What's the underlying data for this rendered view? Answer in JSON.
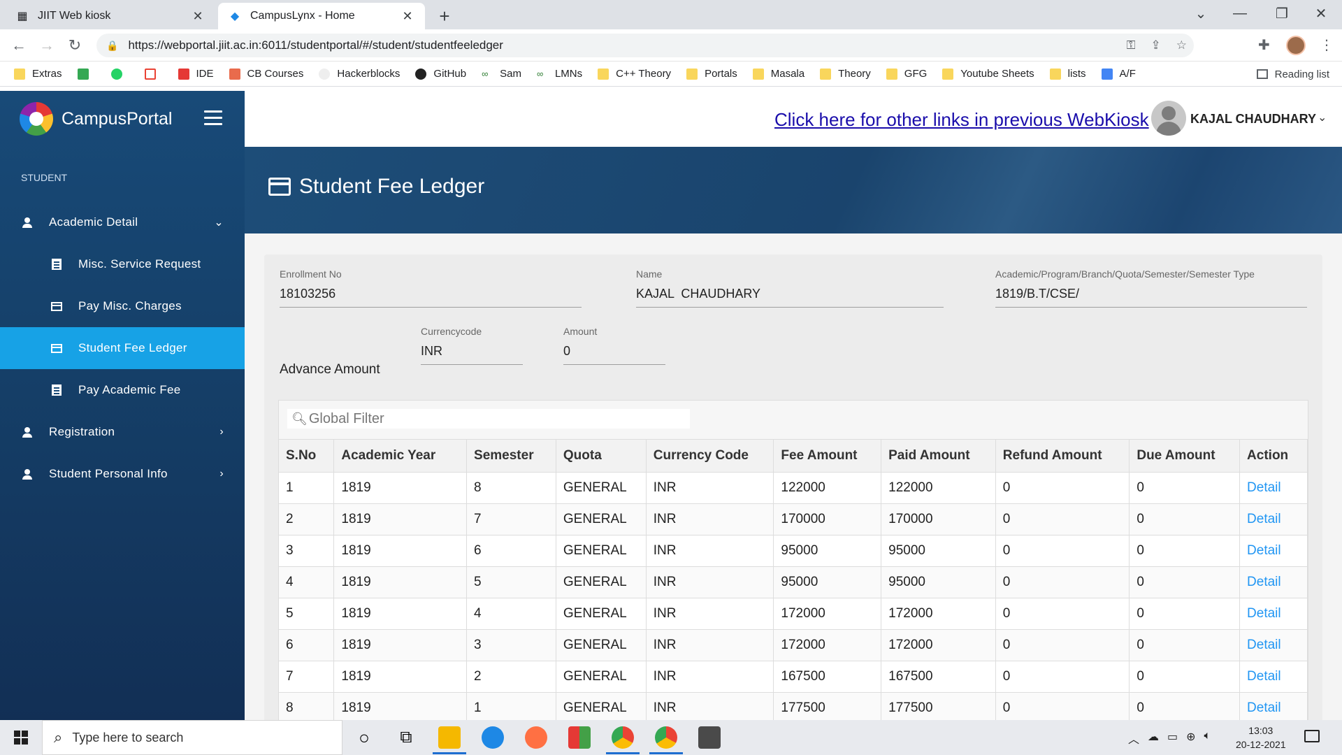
{
  "browser": {
    "tabs": [
      {
        "title": "JIIT Web kiosk",
        "active": false
      },
      {
        "title": "CampusLynx - Home",
        "active": true
      }
    ],
    "url": "https://webportal.jiit.ac.in:6011/studentportal/#/student/studentfeeledger",
    "bookmarks": [
      "Extras",
      "",
      "",
      "",
      "IDE",
      "CB Courses",
      "Hackerblocks",
      "GitHub",
      "Sam",
      "LMNs",
      "C++ Theory",
      "Portals",
      "Masala",
      "Theory",
      "GFG",
      "Youtube Sheets",
      "lists",
      "A/F"
    ],
    "reading_list": "Reading list"
  },
  "sidebar": {
    "brand": "CampusPortal",
    "section": "STUDENT",
    "items": [
      {
        "label": "Academic Detail",
        "icon": "person-icon",
        "chevron": "⌄"
      },
      {
        "label": "Misc. Service Request",
        "icon": "document-icon"
      },
      {
        "label": "Pay Misc. Charges",
        "icon": "card-icon"
      },
      {
        "label": "Student Fee Ledger",
        "icon": "card-icon",
        "active": true
      },
      {
        "label": "Pay Academic Fee",
        "icon": "document-icon"
      },
      {
        "label": "Registration",
        "icon": "person-icon",
        "chevron": "›"
      },
      {
        "label": "Student Personal Info",
        "icon": "person-icon",
        "chevron": "›"
      }
    ]
  },
  "header": {
    "link": "Click here for other links in previous WebKiosk",
    "user": "KAJAL CHAUDHARY"
  },
  "page": {
    "title": "Student Fee Ledger"
  },
  "form": {
    "enrollment_label": "Enrollment No",
    "enrollment_value": "18103256",
    "name_label": "Name",
    "name_value": "KAJAL  CHAUDHARY",
    "program_label": "Academic/Program/Branch/Quota/Semester/Semester Type",
    "program_value": "1819/B.T/CSE/",
    "advance_label": "Advance Amount",
    "currency_label": "Currencycode",
    "currency_value": "INR",
    "amount_label": "Amount",
    "amount_value": "0"
  },
  "table": {
    "filter_placeholder": "Global Filter",
    "columns": [
      "S.No",
      "Academic Year",
      "Semester",
      "Quota",
      "Currency Code",
      "Fee Amount",
      "Paid Amount",
      "Refund Amount",
      "Due Amount",
      "Action"
    ],
    "rows": [
      [
        "1",
        "1819",
        "8",
        "GENERAL",
        "INR",
        "122000",
        "122000",
        "0",
        "0",
        "Detail"
      ],
      [
        "2",
        "1819",
        "7",
        "GENERAL",
        "INR",
        "170000",
        "170000",
        "0",
        "0",
        "Detail"
      ],
      [
        "3",
        "1819",
        "6",
        "GENERAL",
        "INR",
        "95000",
        "95000",
        "0",
        "0",
        "Detail"
      ],
      [
        "4",
        "1819",
        "5",
        "GENERAL",
        "INR",
        "95000",
        "95000",
        "0",
        "0",
        "Detail"
      ],
      [
        "5",
        "1819",
        "4",
        "GENERAL",
        "INR",
        "172000",
        "172000",
        "0",
        "0",
        "Detail"
      ],
      [
        "6",
        "1819",
        "3",
        "GENERAL",
        "INR",
        "172000",
        "172000",
        "0",
        "0",
        "Detail"
      ],
      [
        "7",
        "1819",
        "2",
        "GENERAL",
        "INR",
        "167500",
        "167500",
        "0",
        "0",
        "Detail"
      ],
      [
        "8",
        "1819",
        "1",
        "GENERAL",
        "INR",
        "177500",
        "177500",
        "0",
        "0",
        "Detail"
      ]
    ]
  },
  "taskbar": {
    "search_placeholder": "Type here to search",
    "time": "13:03",
    "date": "20-12-2021"
  }
}
